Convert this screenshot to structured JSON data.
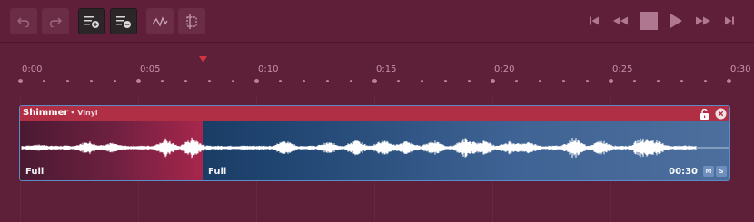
{
  "toolbar": {
    "buttons": [
      {
        "name": "undo",
        "icon": "undo-icon"
      },
      {
        "name": "redo",
        "icon": "redo-icon"
      },
      {
        "name": "add-track",
        "icon": "list-add-icon"
      },
      {
        "name": "remove-track",
        "icon": "list-remove-icon"
      },
      {
        "name": "envelope",
        "icon": "envelope-icon"
      },
      {
        "name": "trim",
        "icon": "crop-icon"
      }
    ],
    "transport": [
      "skip-to-start-icon",
      "rewind-icon",
      "stop-icon",
      "play-icon",
      "fast-forward-icon",
      "skip-to-end-icon"
    ]
  },
  "ruler": {
    "labels": [
      "0:00",
      "0:05",
      "0:10",
      "0:15",
      "0:20",
      "0:25",
      "0:30"
    ]
  },
  "playhead": {
    "time_seconds": 7.5
  },
  "clip": {
    "title": "Shimmer",
    "subtitle": "• Vinyl",
    "left_label": "Full",
    "right_label": "Full",
    "duration": "00:30",
    "mute_label": "M",
    "solo_label": "S",
    "lock_icon": "unlock-icon",
    "close_icon": "close-icon"
  },
  "colors": {
    "background": "#5e1f38",
    "clip_header": "#b02f44",
    "clip_border": "#5b8cc8",
    "playhead": "#c0303c"
  }
}
